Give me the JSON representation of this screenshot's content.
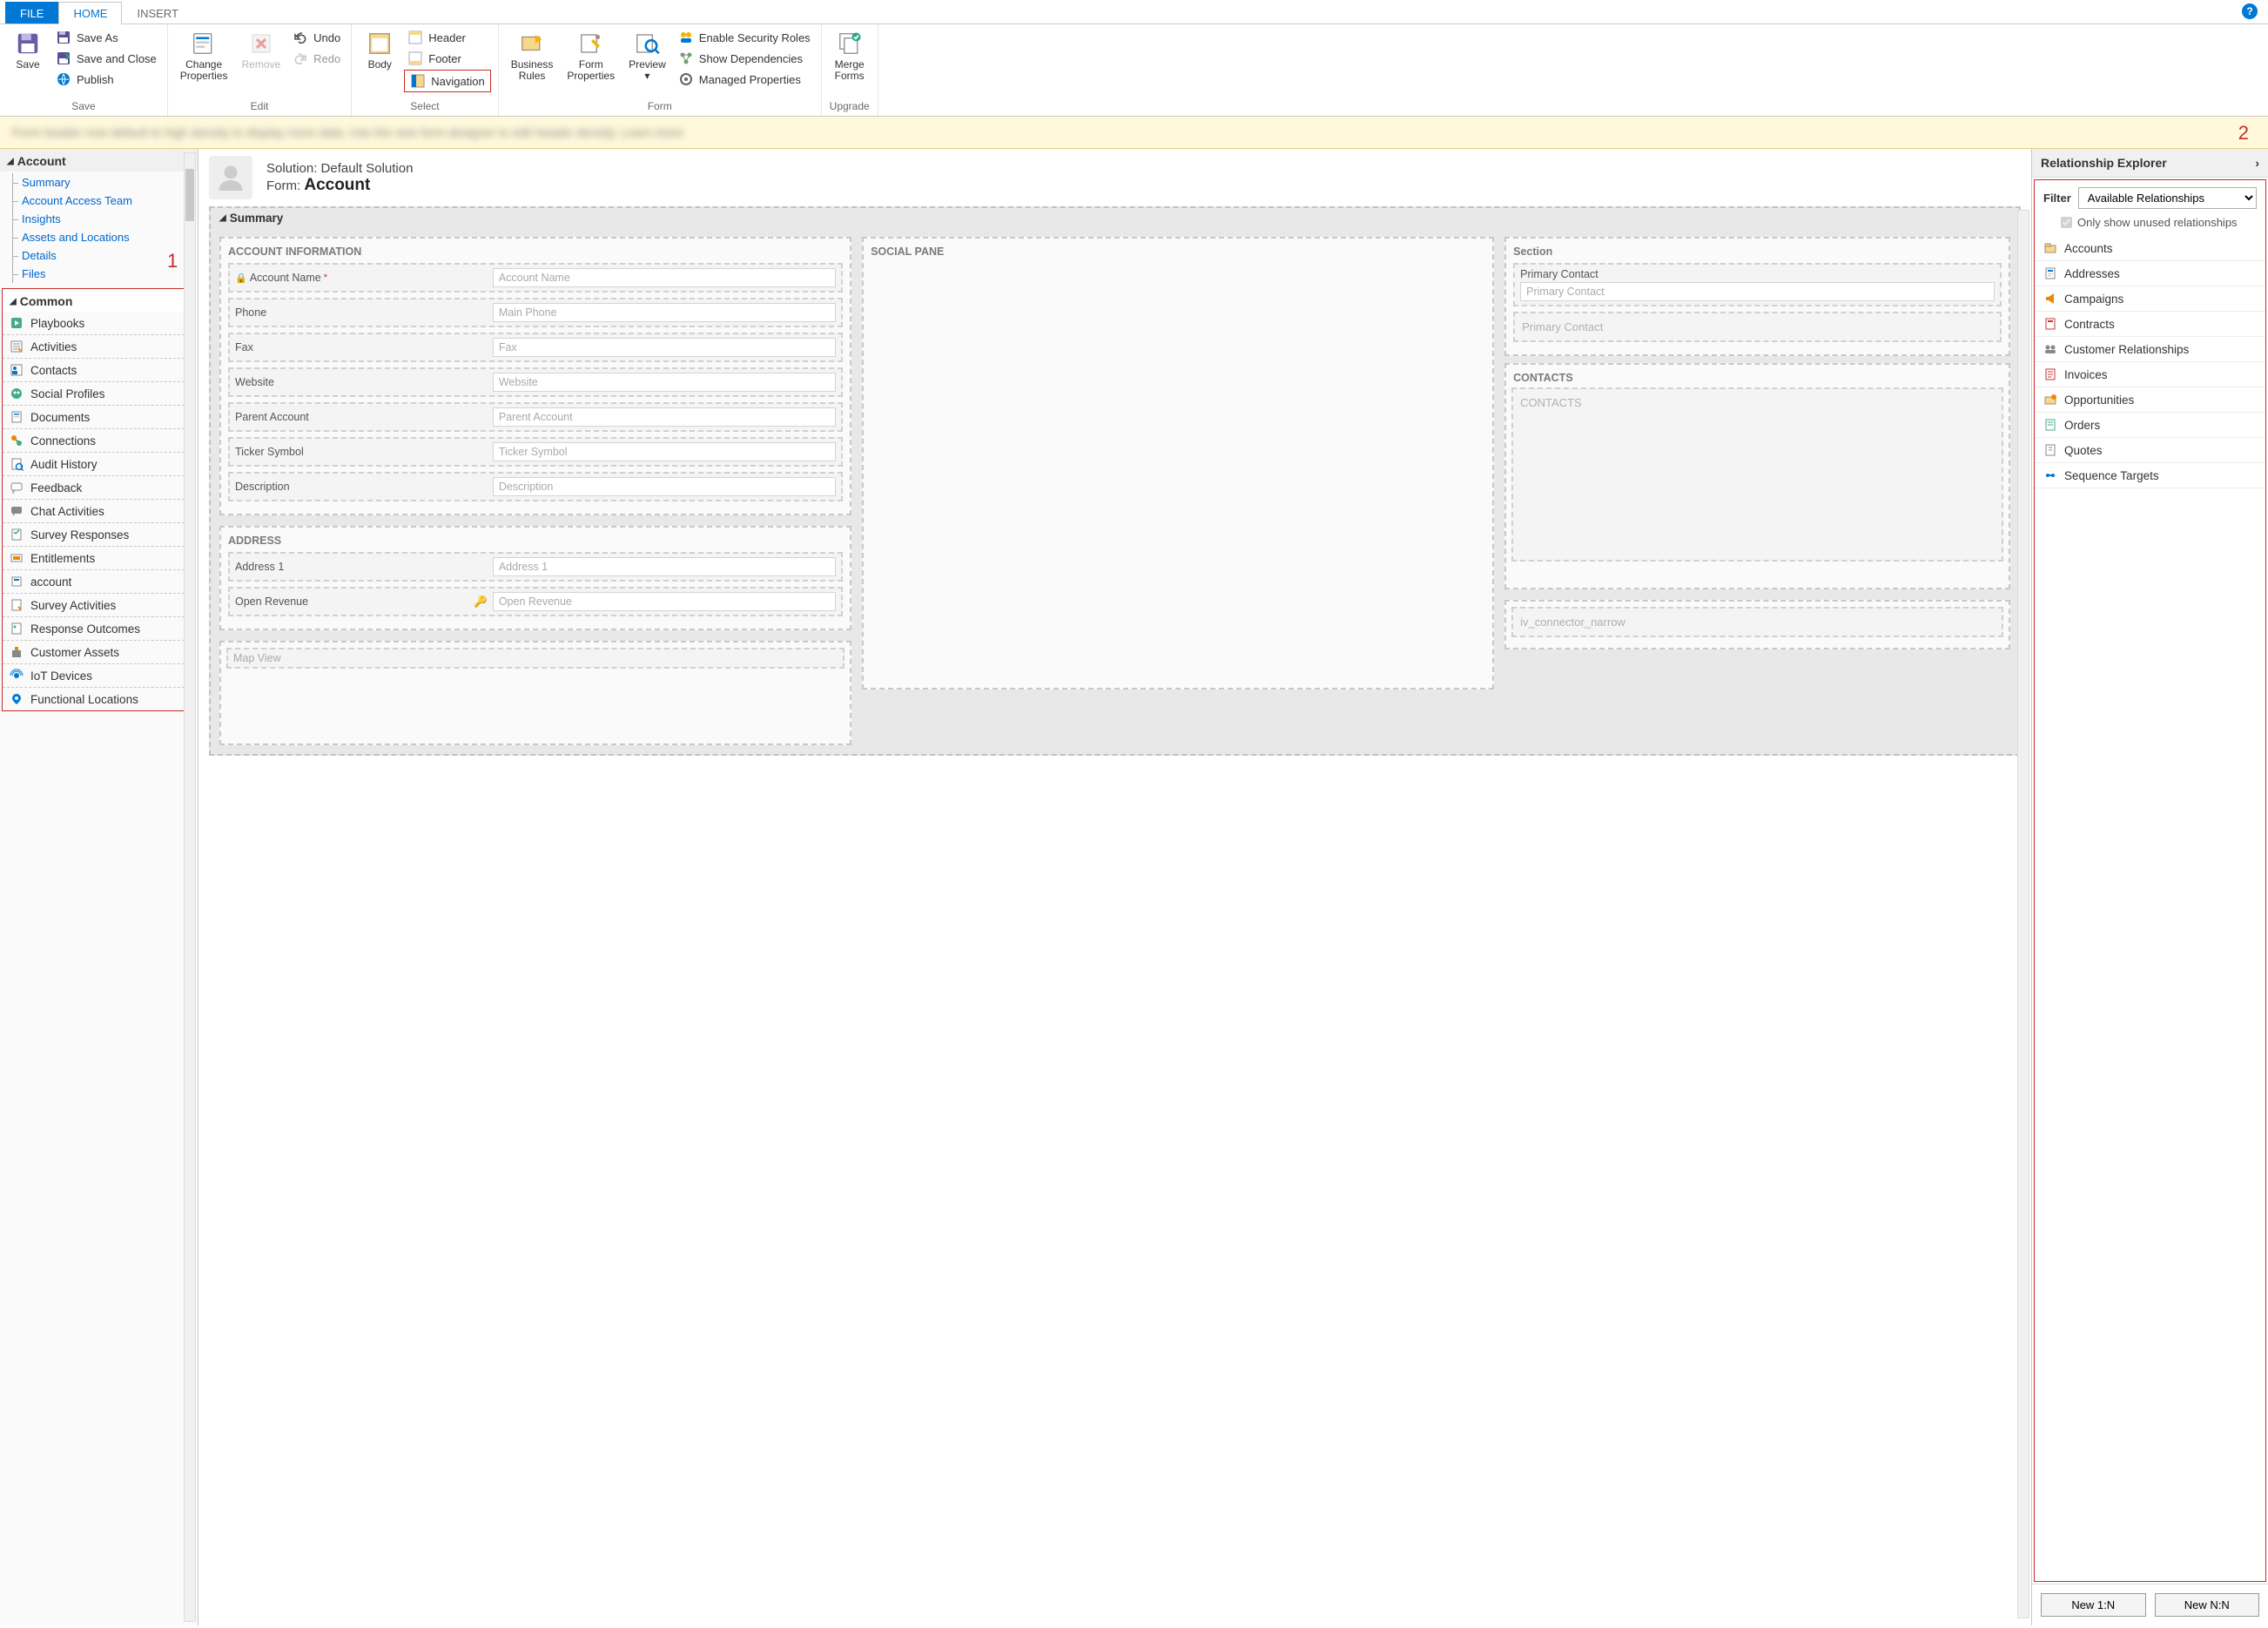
{
  "tabs": {
    "file": "FILE",
    "home": "HOME",
    "insert": "INSERT"
  },
  "ribbon": {
    "save_group": {
      "save": "Save",
      "save_as": "Save As",
      "save_close": "Save and Close",
      "publish": "Publish",
      "label": "Save"
    },
    "edit_group": {
      "change_props": "Change\nProperties",
      "remove": "Remove",
      "undo": "Undo",
      "redo": "Redo",
      "label": "Edit"
    },
    "select_group": {
      "body": "Body",
      "header": "Header",
      "footer": "Footer",
      "navigation": "Navigation",
      "label": "Select"
    },
    "form_group": {
      "biz_rules": "Business\nRules",
      "form_props": "Form\nProperties",
      "preview": "Preview",
      "enable_security": "Enable Security Roles",
      "show_deps": "Show Dependencies",
      "managed_props": "Managed Properties",
      "label": "Form"
    },
    "upgrade_group": {
      "merge_forms": "Merge\nForms",
      "label": "Upgrade"
    }
  },
  "callouts": {
    "one": "1",
    "two": "2"
  },
  "left": {
    "account_header": "Account",
    "tree": [
      "Summary",
      "Account Access Team",
      "Insights",
      "Assets and Locations",
      "Details",
      "Files"
    ],
    "common_header": "Common",
    "common": [
      {
        "icon": "playbook",
        "label": "Playbooks"
      },
      {
        "icon": "activity",
        "label": "Activities"
      },
      {
        "icon": "contacts",
        "label": "Contacts"
      },
      {
        "icon": "social",
        "label": "Social Profiles"
      },
      {
        "icon": "doc",
        "label": "Documents"
      },
      {
        "icon": "conn",
        "label": "Connections"
      },
      {
        "icon": "audit",
        "label": "Audit History"
      },
      {
        "icon": "feedback",
        "label": "Feedback"
      },
      {
        "icon": "chat",
        "label": "Chat Activities"
      },
      {
        "icon": "survey",
        "label": "Survey Responses"
      },
      {
        "icon": "ent",
        "label": "Entitlements"
      },
      {
        "icon": "acct",
        "label": "account"
      },
      {
        "icon": "sact",
        "label": "Survey Activities"
      },
      {
        "icon": "resp",
        "label": "Response Outcomes"
      },
      {
        "icon": "cust",
        "label": "Customer Assets"
      },
      {
        "icon": "iot",
        "label": "IoT Devices"
      },
      {
        "icon": "loc",
        "label": "Functional Locations"
      }
    ]
  },
  "center": {
    "solution_label": "Solution:",
    "solution": "Default Solution",
    "form_label": "Form:",
    "form": "Account",
    "tab_label": "Summary",
    "sec_acct_info": "ACCOUNT INFORMATION",
    "fields_acct": [
      {
        "label": "Account Name",
        "placeholder": "Account Name",
        "lock": true,
        "req": true
      },
      {
        "label": "Phone",
        "placeholder": "Main Phone"
      },
      {
        "label": "Fax",
        "placeholder": "Fax"
      },
      {
        "label": "Website",
        "placeholder": "Website"
      },
      {
        "label": "Parent Account",
        "placeholder": "Parent Account"
      },
      {
        "label": "Ticker Symbol",
        "placeholder": "Ticker Symbol"
      },
      {
        "label": "Description",
        "placeholder": "Description"
      }
    ],
    "sec_address": "ADDRESS",
    "fields_addr": [
      {
        "label": "Address 1",
        "placeholder": "Address 1"
      },
      {
        "label": "Open Revenue",
        "placeholder": "Open Revenue",
        "locked_right": true
      }
    ],
    "map_view": "Map View",
    "sec_social": "SOCIAL PANE",
    "sec_section": "Section",
    "primary_contact_label": "Primary Contact",
    "primary_contact_ph": "Primary Contact",
    "primary_contact2_ph": "Primary Contact",
    "contacts_title": "CONTACTS",
    "contacts_ph": "CONTACTS",
    "iv_conn": "iv_connector_narrow"
  },
  "right": {
    "title": "Relationship Explorer",
    "filter_label": "Filter",
    "filter_value": "Available Relationships",
    "only_unused": "Only show unused relationships",
    "items": [
      {
        "icon": "folder",
        "label": "Accounts"
      },
      {
        "icon": "addr",
        "label": "Addresses"
      },
      {
        "icon": "camp",
        "label": "Campaigns"
      },
      {
        "icon": "contract",
        "label": "Contracts"
      },
      {
        "icon": "custrel",
        "label": "Customer Relationships"
      },
      {
        "icon": "invoice",
        "label": "Invoices"
      },
      {
        "icon": "opp",
        "label": "Opportunities"
      },
      {
        "icon": "order",
        "label": "Orders"
      },
      {
        "icon": "quote",
        "label": "Quotes"
      },
      {
        "icon": "seq",
        "label": "Sequence Targets"
      }
    ],
    "new_1n": "New 1:N",
    "new_nn": "New N:N"
  }
}
